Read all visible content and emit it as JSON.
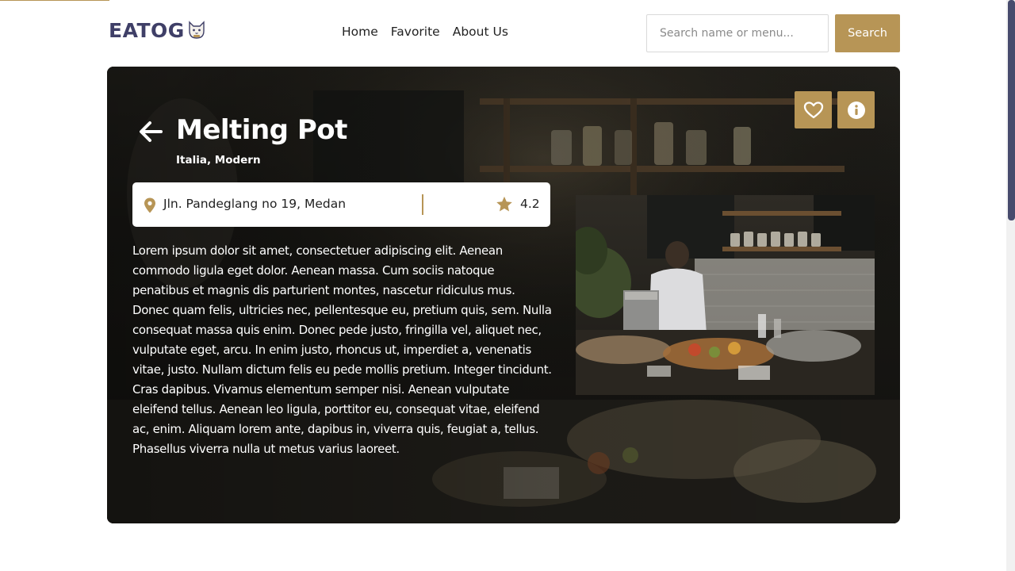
{
  "header": {
    "logo_text": "EATOG",
    "nav": [
      {
        "label": "Home"
      },
      {
        "label": "Favorite"
      },
      {
        "label": "About Us"
      }
    ],
    "search": {
      "placeholder": "Search name or menu...",
      "value": "",
      "button_label": "Search"
    }
  },
  "restaurant": {
    "name": "Melting Pot",
    "categories": "Italia, Modern",
    "address": "Jln. Pandeglang no 19, Medan",
    "rating": "4.2",
    "description": "Lorem ipsum dolor sit amet, consectetuer adipiscing elit. Aenean commodo ligula eget dolor. Aenean massa. Cum sociis natoque penatibus et magnis dis parturient montes, nascetur ridiculus mus. Donec quam felis, ultricies nec, pellentesque eu, pretium quis, sem. Nulla consequat massa quis enim. Donec pede justo, fringilla vel, aliquet nec, vulputate eget, arcu. In enim justo, rhoncus ut, imperdiet a, venenatis vitae, justo. Nullam dictum felis eu pede mollis pretium. Integer tincidunt. Cras dapibus. Vivamus elementum semper nisi. Aenean vulputate eleifend tellus. Aenean leo ligula, porttitor eu, consequat vitae, eleifend ac, enim. Aliquam lorem ante, dapibus in, viverra quis, feugiat a, tellus. Phasellus viverra nulla ut metus varius laoreet."
  },
  "icons": {
    "back": "arrow-left-icon",
    "favorite": "heart-icon",
    "info": "info-icon",
    "location": "map-pin-icon",
    "rating": "star-icon"
  },
  "colors": {
    "accent": "#b79556",
    "logo": "#3f3f67",
    "scrollbar_thumb": "#474b6d"
  }
}
